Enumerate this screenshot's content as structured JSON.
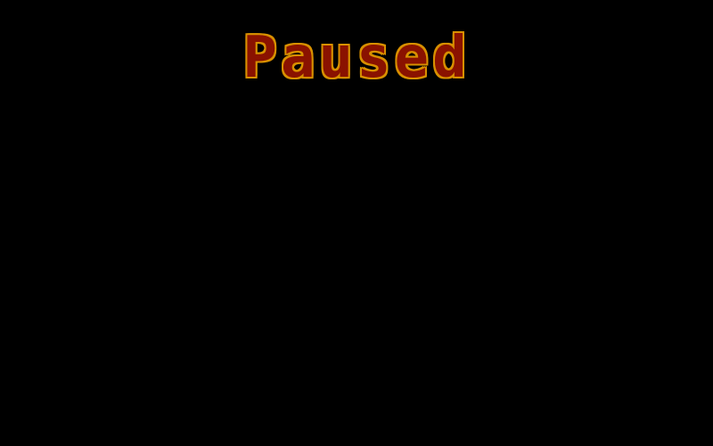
{
  "overlay": {
    "title": "Paused",
    "title_fill_color": "#8a1200",
    "title_outline_color": "#d89000",
    "background_color": "#000000"
  }
}
